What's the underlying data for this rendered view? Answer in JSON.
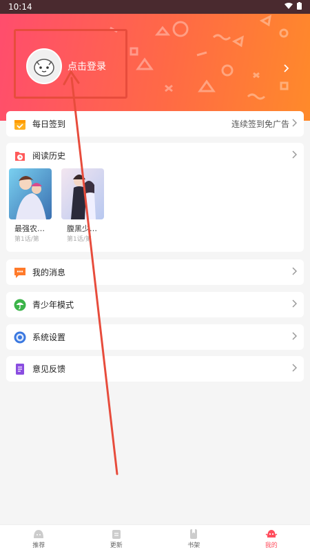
{
  "status_bar": {
    "time": "10:14"
  },
  "header": {
    "login_label": "点击登录"
  },
  "menu": {
    "checkin": {
      "label": "每日签到",
      "right_text": "连续签到免广告"
    },
    "history": {
      "label": "阅读历史",
      "books": [
        {
          "title": "最强农…",
          "progress": "第1话/第"
        },
        {
          "title": "腹黑少…",
          "progress": "第1话/第"
        }
      ]
    },
    "messages": {
      "label": "我的消息"
    },
    "youth_mode": {
      "label": "青少年模式"
    },
    "settings": {
      "label": "系统设置"
    },
    "feedback": {
      "label": "意见反馈"
    }
  },
  "tabbar": {
    "tabs": [
      {
        "label": "推荐"
      },
      {
        "label": "更新"
      },
      {
        "label": "书架"
      },
      {
        "label": "我的"
      }
    ]
  },
  "colors": {
    "accent": "#ff4d5d",
    "annotation": "#e74c3c"
  }
}
